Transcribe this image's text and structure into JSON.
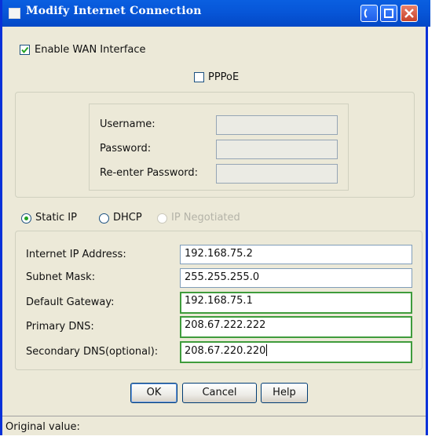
{
  "window": {
    "title": "Modify Internet Connection",
    "icons": [
      "minimize-icon",
      "maximize-icon",
      "close-icon"
    ]
  },
  "wan": {
    "enable_label": "Enable WAN Interface",
    "enabled": true
  },
  "pppoe": {
    "label": "PPPoE",
    "checked": false,
    "username_label": "Username:",
    "password_label": "Password:",
    "reenter_label": "Re-enter Password:",
    "username_value": "",
    "password_value": "",
    "reenter_value": ""
  },
  "mode": {
    "static_label": "Static IP",
    "dhcp_label": "DHCP",
    "negotiated_label": "IP Negotiated",
    "selected": "Static IP"
  },
  "static": {
    "ip_label": "Internet IP Address:",
    "ip_value": "192.168.75.2",
    "mask_label": "Subnet Mask:",
    "mask_value": "255.255.255.0",
    "gateway_label": "Default Gateway:",
    "gateway_value": "192.168.75.1",
    "dns1_label": "Primary DNS:",
    "dns1_value": "208.67.222.222",
    "dns2_label": "Secondary DNS(optional):",
    "dns2_value": "208.67.220.220"
  },
  "buttons": {
    "ok": "OK",
    "cancel": "Cancel",
    "help": "Help"
  },
  "status": {
    "text": "Original value:"
  },
  "figure_id": "189199",
  "colors": {
    "titlebar": "#0756d8",
    "frame": "#0831d9",
    "dialog_bg": "#ece9d8",
    "valid_border": "#3f9c3c",
    "radio_dot": "#21a121"
  }
}
